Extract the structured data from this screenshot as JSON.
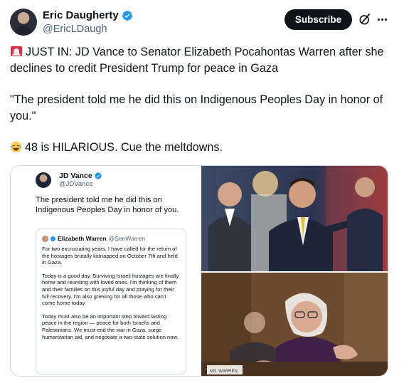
{
  "author": {
    "display_name": "Eric Daugherty",
    "handle": "@EricLDaugh",
    "verified": true
  },
  "actions": {
    "subscribe_label": "Subscribe",
    "grok_icon": "grok-icon",
    "more_icon": "more-icon"
  },
  "tweet": {
    "line1": "JUST IN: JD Vance to Senator Elizabeth Pocahontas Warren after she declines to credit President Trump for peace in Gaza",
    "line2": "\"The president told me he did this on Indigenous Peoples Day in honor of you.\"",
    "line3": "48 is HILARIOUS. Cue the meltdowns.",
    "emoji1": "siren-emoji",
    "emoji3": "laughing-emoji"
  },
  "embedded": {
    "name": "JD Vance",
    "handle": "@JDVance",
    "text": "The president told me he did this on Indigenous Peoples Day in honor of you.",
    "quote": {
      "name": "Elizabeth Warren",
      "handle": "@SenWarren",
      "p1": "For two excruciating years, I have called for the return of the hostages brutally kidnapped on October 7th and held in Gaza.",
      "p2": "Today is a good day. Surviving Israeli hostages are finally home and reuniting with loved ones. I'm thinking of them and their families on this joyful day and praying for their full recovery. I'm also grieving for all those who can't come home today.",
      "p3": "Today must also be an important step toward lasting peace in the region — peace for both Israelis and Palestinians. We must end the war in Gaza, surge humanitarian aid, and negotiate a two-state solution now."
    }
  },
  "photos": {
    "top_caption": "",
    "bottom_nameplate": "MS. WARREN"
  },
  "colors": {
    "text": "#0f1419",
    "secondary": "#536471",
    "verified": "#1d9bf0",
    "border": "#cfd9de"
  }
}
